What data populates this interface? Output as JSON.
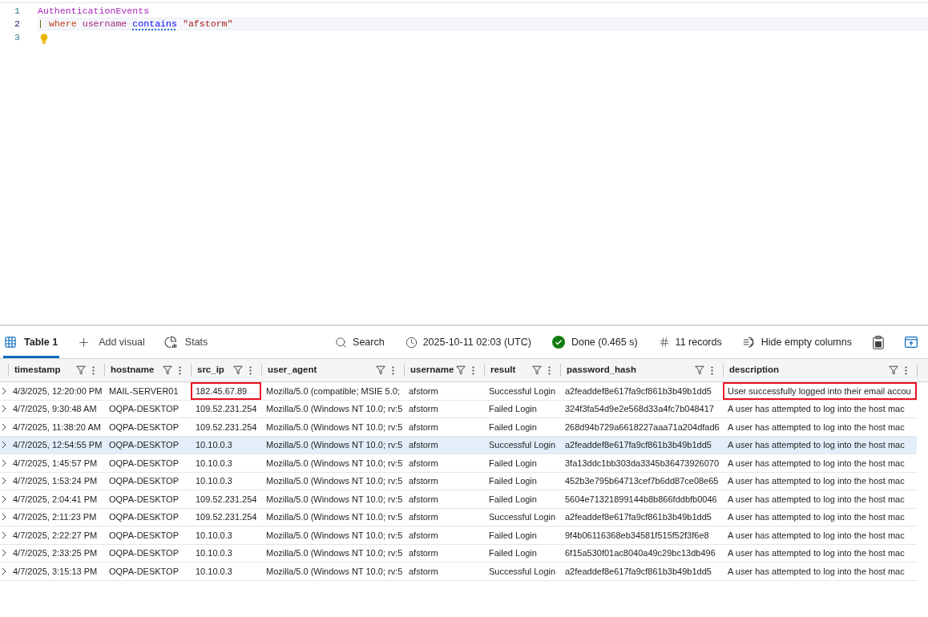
{
  "editor": {
    "lines": [
      {
        "number": "1",
        "current": false,
        "tokens": [
          {
            "text": "AuthenticationEvents",
            "kind": "table",
            "squiggle": false
          }
        ]
      },
      {
        "number": "2",
        "current": true,
        "tokens": [
          {
            "text": "|",
            "kind": "pipe",
            "squiggle": false
          },
          {
            "text": "where",
            "kind": "keyword",
            "squiggle": false
          },
          {
            "text": "username",
            "kind": "column",
            "squiggle": false
          },
          {
            "text": "contains",
            "kind": "operator",
            "squiggle": true
          },
          {
            "text": "\"afstorm\"",
            "kind": "string",
            "squiggle": false
          }
        ]
      },
      {
        "number": "3",
        "current": false,
        "lightbulb": true
      }
    ]
  },
  "toolbar": {
    "tabs": [
      {
        "label": "Table 1",
        "kind": "table",
        "selected": true
      },
      {
        "label": "Add visual",
        "kind": "add",
        "selected": false
      },
      {
        "label": "Stats",
        "kind": "stats",
        "selected": false
      }
    ],
    "items": [
      {
        "kind": "search",
        "label": "Search"
      },
      {
        "kind": "time",
        "label": "2025-10-11 02:03 (UTC)"
      },
      {
        "kind": "status",
        "label": "Done (0.465 s)"
      },
      {
        "kind": "count",
        "label": "11 records"
      },
      {
        "kind": "hide",
        "label": "Hide empty columns"
      },
      {
        "kind": "copy"
      },
      {
        "kind": "expand"
      }
    ]
  },
  "table": {
    "columns": [
      "timestamp",
      "hostname",
      "src_ip",
      "user_agent",
      "username",
      "result",
      "password_hash",
      "description"
    ],
    "rows": [
      {
        "selected": false,
        "expanded": false,
        "cells": [
          {
            "text": "4/3/2025, 12:20:00 PM",
            "outlined": false
          },
          {
            "text": "MAIL-SERVER01",
            "outlined": false
          },
          {
            "text": "182.45.67.89",
            "outlined": true
          },
          {
            "text": "Mozilla/5.0 (compatible; MSIE 5.0;",
            "outlined": false
          },
          {
            "text": "afstorm",
            "outlined": false
          },
          {
            "text": "Successful Login",
            "outlined": false
          },
          {
            "text": "a2feaddef8e617fa9cf861b3b49b1dd5",
            "outlined": false
          },
          {
            "text": "User successfully logged into their email accou",
            "outlined": true
          }
        ]
      },
      {
        "selected": false,
        "expanded": false,
        "cells": [
          {
            "text": "4/7/2025, 9:30:48 AM",
            "outlined": false
          },
          {
            "text": "OQPA-DESKTOP",
            "outlined": false
          },
          {
            "text": "109.52.231.254",
            "outlined": false
          },
          {
            "text": "Mozilla/5.0 (Windows NT 10.0; rv:5",
            "outlined": false
          },
          {
            "text": "afstorm",
            "outlined": false
          },
          {
            "text": "Failed Login",
            "outlined": false
          },
          {
            "text": "324f3fa54d9e2e568d33a4fc7b048417",
            "outlined": false
          },
          {
            "text": "A user has attempted to log into the host mac",
            "outlined": false
          }
        ]
      },
      {
        "selected": false,
        "expanded": false,
        "cells": [
          {
            "text": "4/7/2025, 11:38:20 AM",
            "outlined": false
          },
          {
            "text": "OQPA-DESKTOP",
            "outlined": false
          },
          {
            "text": "109.52.231.254",
            "outlined": false
          },
          {
            "text": "Mozilla/5.0 (Windows NT 10.0; rv:5",
            "outlined": false
          },
          {
            "text": "afstorm",
            "outlined": false
          },
          {
            "text": "Failed Login",
            "outlined": false
          },
          {
            "text": "268d94b729a6618227aaa71a204dfad6",
            "outlined": false
          },
          {
            "text": "A user has attempted to log into the host mac",
            "outlined": false
          }
        ]
      },
      {
        "selected": true,
        "expanded": false,
        "cells": [
          {
            "text": "4/7/2025, 12:54:55 PM",
            "outlined": false
          },
          {
            "text": "OQPA-DESKTOP",
            "outlined": false
          },
          {
            "text": "10.10.0.3",
            "outlined": false
          },
          {
            "text": "Mozilla/5.0 (Windows NT 10.0; rv:5",
            "outlined": false
          },
          {
            "text": "afstorm",
            "outlined": false
          },
          {
            "text": "Successful Login",
            "outlined": false
          },
          {
            "text": "a2feaddef8e617fa9cf861b3b49b1dd5",
            "outlined": false
          },
          {
            "text": "A user has attempted to log into the host mac",
            "outlined": false
          }
        ]
      },
      {
        "selected": false,
        "expanded": false,
        "cells": [
          {
            "text": "4/7/2025, 1:45:57 PM",
            "outlined": false
          },
          {
            "text": "OQPA-DESKTOP",
            "outlined": false
          },
          {
            "text": "10.10.0.3",
            "outlined": false
          },
          {
            "text": "Mozilla/5.0 (Windows NT 10.0; rv:5",
            "outlined": false
          },
          {
            "text": "afstorm",
            "outlined": false
          },
          {
            "text": "Failed Login",
            "outlined": false
          },
          {
            "text": "3fa13ddc1bb303da3345b36473926070",
            "outlined": false
          },
          {
            "text": "A user has attempted to log into the host mac",
            "outlined": false
          }
        ]
      },
      {
        "selected": false,
        "expanded": false,
        "cells": [
          {
            "text": "4/7/2025, 1:53:24 PM",
            "outlined": false
          },
          {
            "text": "OQPA-DESKTOP",
            "outlined": false
          },
          {
            "text": "10.10.0.3",
            "outlined": false
          },
          {
            "text": "Mozilla/5.0 (Windows NT 10.0; rv:5",
            "outlined": false
          },
          {
            "text": "afstorm",
            "outlined": false
          },
          {
            "text": "Failed Login",
            "outlined": false
          },
          {
            "text": "452b3e795b64713cef7b6dd87ce08e65",
            "outlined": false
          },
          {
            "text": "A user has attempted to log into the host mac",
            "outlined": false
          }
        ]
      },
      {
        "selected": false,
        "expanded": false,
        "cells": [
          {
            "text": "4/7/2025, 2:04:41 PM",
            "outlined": false
          },
          {
            "text": "OQPA-DESKTOP",
            "outlined": false
          },
          {
            "text": "109.52.231.254",
            "outlined": false
          },
          {
            "text": "Mozilla/5.0 (Windows NT 10.0; rv:5",
            "outlined": false
          },
          {
            "text": "afstorm",
            "outlined": false
          },
          {
            "text": "Failed Login",
            "outlined": false
          },
          {
            "text": "5604e71321899144b8b866fddbfb0046",
            "outlined": false
          },
          {
            "text": "A user has attempted to log into the host mac",
            "outlined": false
          }
        ]
      },
      {
        "selected": false,
        "expanded": false,
        "cells": [
          {
            "text": "4/7/2025, 2:11:23 PM",
            "outlined": false
          },
          {
            "text": "OQPA-DESKTOP",
            "outlined": false
          },
          {
            "text": "109.52.231.254",
            "outlined": false
          },
          {
            "text": "Mozilla/5.0 (Windows NT 10.0; rv:5",
            "outlined": false
          },
          {
            "text": "afstorm",
            "outlined": false
          },
          {
            "text": "Successful Login",
            "outlined": false
          },
          {
            "text": "a2feaddef8e617fa9cf861b3b49b1dd5",
            "outlined": false
          },
          {
            "text": "A user has attempted to log into the host mac",
            "outlined": false
          }
        ]
      },
      {
        "selected": false,
        "expanded": false,
        "cells": [
          {
            "text": "4/7/2025, 2:22:27 PM",
            "outlined": false
          },
          {
            "text": "OQPA-DESKTOP",
            "outlined": false
          },
          {
            "text": "10.10.0.3",
            "outlined": false
          },
          {
            "text": "Mozilla/5.0 (Windows NT 10.0; rv:5",
            "outlined": false
          },
          {
            "text": "afstorm",
            "outlined": false
          },
          {
            "text": "Failed Login",
            "outlined": false
          },
          {
            "text": "9f4b06116368eb34581f515f52f3f6e8",
            "outlined": false
          },
          {
            "text": "A user has attempted to log into the host mac",
            "outlined": false
          }
        ]
      },
      {
        "selected": false,
        "expanded": false,
        "cells": [
          {
            "text": "4/7/2025, 2:33:25 PM",
            "outlined": false
          },
          {
            "text": "OQPA-DESKTOP",
            "outlined": false
          },
          {
            "text": "10.10.0.3",
            "outlined": false
          },
          {
            "text": "Mozilla/5.0 (Windows NT 10.0; rv:5",
            "outlined": false
          },
          {
            "text": "afstorm",
            "outlined": false
          },
          {
            "text": "Failed Login",
            "outlined": false
          },
          {
            "text": "6f15a530f01ac8040a49c29bc13db496",
            "outlined": false
          },
          {
            "text": "A user has attempted to log into the host mac",
            "outlined": false
          }
        ]
      },
      {
        "selected": false,
        "expanded": false,
        "cells": [
          {
            "text": "4/7/2025, 3:15:13 PM",
            "outlined": false
          },
          {
            "text": "OQPA-DESKTOP",
            "outlined": false
          },
          {
            "text": "10.10.0.3",
            "outlined": false
          },
          {
            "text": "Mozilla/5.0 (Windows NT 10.0; rv:5",
            "outlined": false
          },
          {
            "text": "afstorm",
            "outlined": false
          },
          {
            "text": "Successful Login",
            "outlined": false
          },
          {
            "text": "a2feaddef8e617fa9cf861b3b49b1dd5",
            "outlined": false
          },
          {
            "text": "A user has attempted to log into the host mac",
            "outlined": false
          }
        ]
      }
    ]
  }
}
